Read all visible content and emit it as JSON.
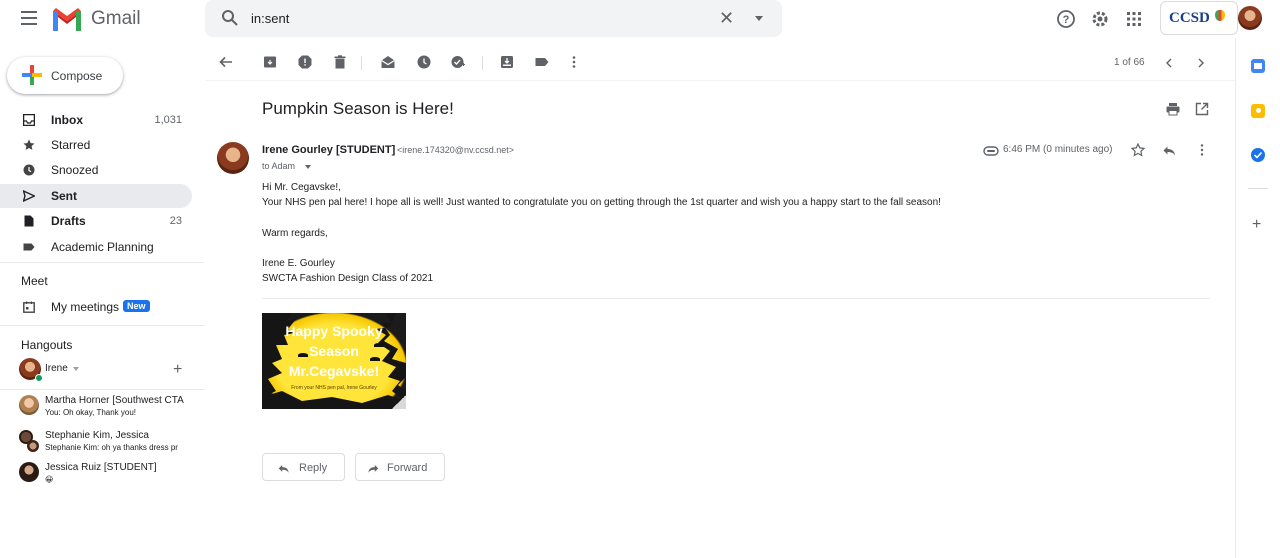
{
  "app": {
    "name": "Gmail"
  },
  "search": {
    "query": "in:sent"
  },
  "org": {
    "name": "CCSD"
  },
  "compose": {
    "label": "Compose"
  },
  "sidebar": {
    "items": [
      {
        "label": "Inbox",
        "count": "1,031"
      },
      {
        "label": "Starred",
        "count": ""
      },
      {
        "label": "Snoozed",
        "count": ""
      },
      {
        "label": "Sent",
        "count": ""
      },
      {
        "label": "Drafts",
        "count": "23"
      },
      {
        "label": "Academic Planning",
        "count": ""
      }
    ]
  },
  "meet": {
    "title": "Meet",
    "my_meetings": "My meetings",
    "badge": "New"
  },
  "hangouts": {
    "title": "Hangouts",
    "me": "Irene",
    "conversations": [
      {
        "name": "Martha Horner [Southwest CTA",
        "snippet": "You: Oh okay, Thank you!"
      },
      {
        "name": "Stephanie Kim, Jessica",
        "snippet": "Stephanie Kim: oh ya thanks dress pr"
      },
      {
        "name": "Jessica Ruiz [STUDENT]",
        "snippet": "😀"
      }
    ]
  },
  "toolbar": {
    "pager": "1 of 66"
  },
  "message": {
    "subject": "Pumpkin Season is Here!",
    "sender": "Irene Gourley [STUDENT]",
    "email": "<irene.174320@nv.ccsd.net>",
    "to": "to Adam",
    "time": "6:46 PM (0 minutes ago)",
    "body": [
      "Hi Mr. Cegavske!,",
      "Your NHS pen pal here!  I hope all is well! Just wanted to congratulate you on getting through the 1st quarter and wish you a happy start to the fall season!",
      "Warm regards,",
      "Irene E. Gourley",
      "SWCTA Fashion Design Class of 2021"
    ],
    "attachment": {
      "lines": [
        "Happy Spooky",
        "Season",
        "Mr.Cegavske!"
      ],
      "small": "From your NHS pen pal, Irene Gourley"
    }
  },
  "actions": {
    "reply": "Reply",
    "forward": "Forward"
  }
}
